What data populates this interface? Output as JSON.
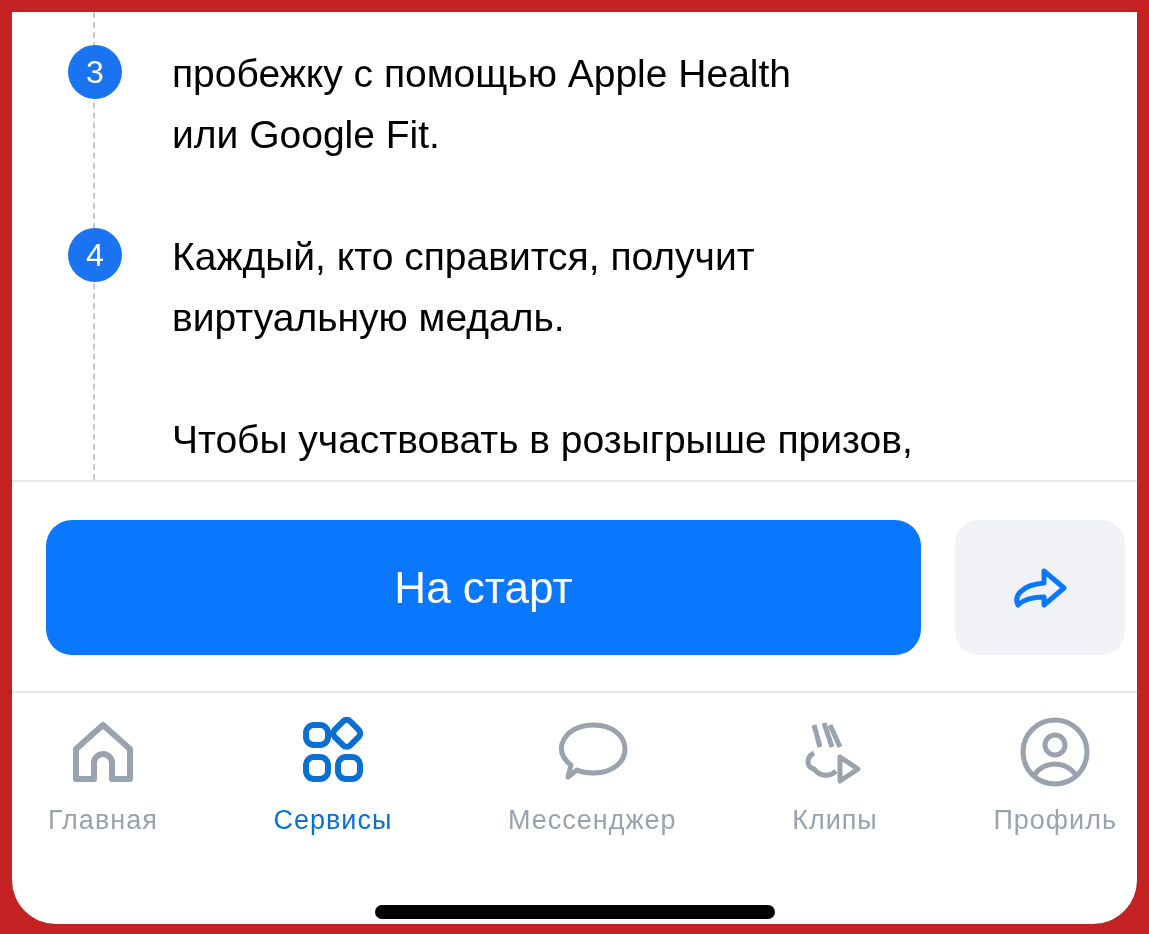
{
  "steps": [
    {
      "number": "3",
      "text": "пробежку с помощью Apple Health\nили Google Fit."
    },
    {
      "number": "4",
      "text": "Каждый, кто справится, получит\nвиртуальную медаль."
    }
  ],
  "note": "Чтобы участвовать в розыгрыше призов,",
  "start_button": "На старт",
  "tabs": [
    {
      "label": "Главная",
      "kind": "home",
      "selected": false
    },
    {
      "label": "Сервисы",
      "kind": "services",
      "selected": true
    },
    {
      "label": "Мессенджер",
      "kind": "chat",
      "selected": false
    },
    {
      "label": "Клипы",
      "kind": "clips",
      "selected": false
    },
    {
      "label": "Профиль",
      "kind": "profile",
      "selected": false
    }
  ]
}
